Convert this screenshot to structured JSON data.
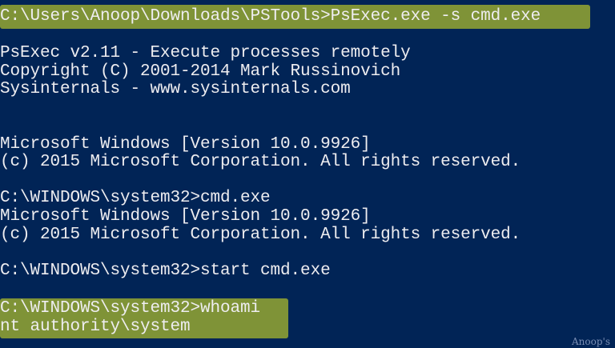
{
  "console": {
    "lines": [
      "C:\\Users\\Anoop\\Downloads\\PSTools>PsExec.exe -s cmd.exe",
      "PsExec v2.11 - Execute processes remotely",
      "Copyright (C) 2001-2014 Mark Russinovich",
      "Sysinternals - www.sysinternals.com",
      "Microsoft Windows [Version 10.0.9926]",
      "(c) 2015 Microsoft Corporation. All rights reserved.",
      "C:\\WINDOWS\\system32>cmd.exe",
      "Microsoft Windows [Version 10.0.9926]",
      "(c) 2015 Microsoft Corporation. All rights reserved.",
      "C:\\WINDOWS\\system32>start cmd.exe",
      "C:\\WINDOWS\\system32>whoami",
      "nt authority\\system"
    ]
  },
  "watermark": "Anoop's",
  "colors": {
    "background": "#012456",
    "text": "#eeedf0",
    "highlight": "#e8ee1f"
  }
}
